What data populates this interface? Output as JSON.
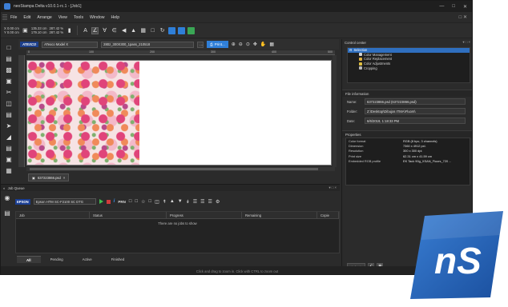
{
  "window": {
    "title": "neoStampa Delta v10.0.1-rc.1 - [Job1]"
  },
  "menu": [
    "File",
    "Edit",
    "Arrange",
    "View",
    "Tools",
    "Window",
    "Help"
  ],
  "toolbar": {
    "x_value": "0.00 cm",
    "y_value": "0.00 cm",
    "w_value": "135.33 cm",
    "h_value": "179.10 cm",
    "sx_value": "287.42 %",
    "sy_value": "287.42 %"
  },
  "docbar": {
    "brand": "ATEXCO",
    "model": "ATexco Model X",
    "config": "280z_300X300_1pass_210518",
    "print_label": "Print..."
  },
  "ruler": [
    "0",
    "100",
    "200",
    "300",
    "400",
    "500"
  ],
  "document_tab": "637223866.psd",
  "control_center": {
    "title": "Control center",
    "items": [
      "Selection",
      "Color Management",
      "Color Replacement",
      "Color Adjustments",
      "Cropping"
    ]
  },
  "file_information": {
    "title": "File information",
    "name_label": "Name:",
    "name_value": "637223866.psd (637223866.psd)",
    "folder_label": "Folder:",
    "folder_value": "Z:\\Desktop\\Dibujos ITMA\\Fluors\\",
    "date_label": "Date:",
    "date_value": "6/6/2019, 1:18:33 PM"
  },
  "properties": {
    "title": "Properties",
    "rows": [
      {
        "k": "Color format",
        "v": "RGB (8 bpc, 3 channels)"
      },
      {
        "k": "Dimension",
        "v": "7360 x 4912 pxl."
      },
      {
        "k": "Resolution",
        "v": "300 x 300 dpi."
      },
      {
        "k": "Print size",
        "v": "62.31 cm x 41.59 cm"
      },
      {
        "k": "Embedded RGB profile",
        "v": "EK Tack 90g_XSAN_Fluors_720 ..."
      }
    ],
    "apply_label": "Apply"
  },
  "job_queue": {
    "title": "Job Queue",
    "brand": "EPSON",
    "printer": "Epson HTM SC-F2100 SC DTG",
    "prn_label": "PRN",
    "columns": [
      "Job",
      "Status",
      "Progress",
      "Remaining",
      "Copie"
    ],
    "empty_text": "There are no jobs to show",
    "tabs": [
      "All",
      "Pending",
      "Active",
      "Finished"
    ]
  },
  "status_bar": "Click and drag to zoom in. Click with CTRL to zoom out",
  "logo_text": "nS",
  "colors": {
    "accent": "#2f7fd8",
    "logo_blue": "#1f5fb0"
  }
}
